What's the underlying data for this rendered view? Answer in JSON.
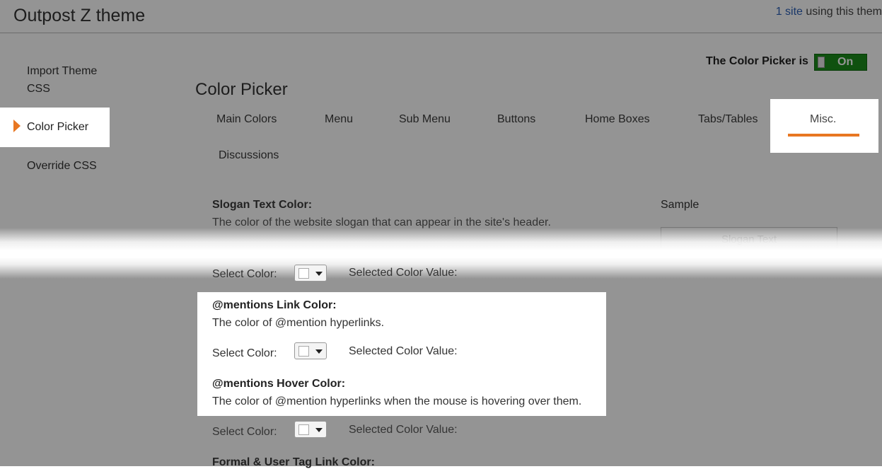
{
  "header": {
    "title": "Outpost Z theme",
    "sites_link": "1 site",
    "sites_suffix": " using this them"
  },
  "sidebar": {
    "items": [
      {
        "label": "Import Theme CSS"
      },
      {
        "label": "Color Picker",
        "active": true
      },
      {
        "label": "Override CSS"
      }
    ]
  },
  "toggle": {
    "label": "The Color Picker is",
    "state": "On"
  },
  "section_title": "Color Picker",
  "tabs": [
    {
      "label": "Main Colors"
    },
    {
      "label": "Menu"
    },
    {
      "label": "Sub Menu"
    },
    {
      "label": "Buttons"
    },
    {
      "label": "Home Boxes"
    },
    {
      "label": "Tabs/Tables"
    },
    {
      "label": "Misc.",
      "active": true
    },
    {
      "label": "Discussions"
    }
  ],
  "sample": {
    "label": "Sample",
    "preview_text": "Slogan Text"
  },
  "fields": [
    {
      "title": "Slogan Text Color:",
      "description": "The color of the website slogan that can appear in the site's header.",
      "select_label": "Select Color:",
      "value_label": "Selected Color Value:"
    },
    {
      "title": "@mentions Link Color:",
      "description": "The color of @mention hyperlinks.",
      "select_label": "Select Color:",
      "value_label": "Selected Color Value:"
    },
    {
      "title": "@mentions Hover Color:",
      "description": "The color of @mention hyperlinks when the mouse is hovering over them.",
      "select_label": "Select Color:",
      "value_label": "Selected Color Value:"
    },
    {
      "title": "Formal & User Tag Link Color:"
    }
  ],
  "colors": {
    "accent": "#e87722",
    "toggle_on": "#1a8c1a",
    "link": "#2b5fb5"
  }
}
